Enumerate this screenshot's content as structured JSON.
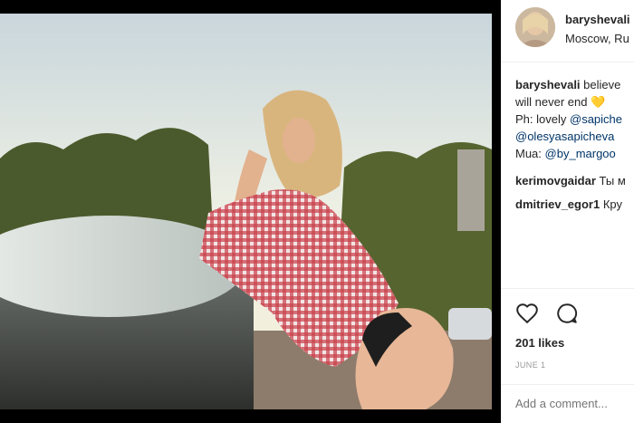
{
  "post": {
    "username": "baryshevali",
    "location": "Moscow, Ru",
    "caption_user": "baryshevali",
    "caption_line1": "believe",
    "caption_line2": "will never end",
    "caption_ph": "Ph: lovely",
    "caption_ph_mention": "@sapiche",
    "caption_mention2": "@olesyasapicheva",
    "caption_mua": "Mua:",
    "caption_mua_mention": "@by_margoo",
    "heart_emoji": "💛",
    "comments": [
      {
        "user": "kerimovgaidar",
        "text": "Ты м"
      },
      {
        "user": "dmitriev_egor1",
        "text": "Кру"
      }
    ],
    "likes": "201 likes",
    "date": "JUNE 1",
    "add_comment_placeholder": "Add a comment..."
  },
  "icons": {
    "like": "heart-outline-icon",
    "comment": "speech-bubble-icon"
  }
}
